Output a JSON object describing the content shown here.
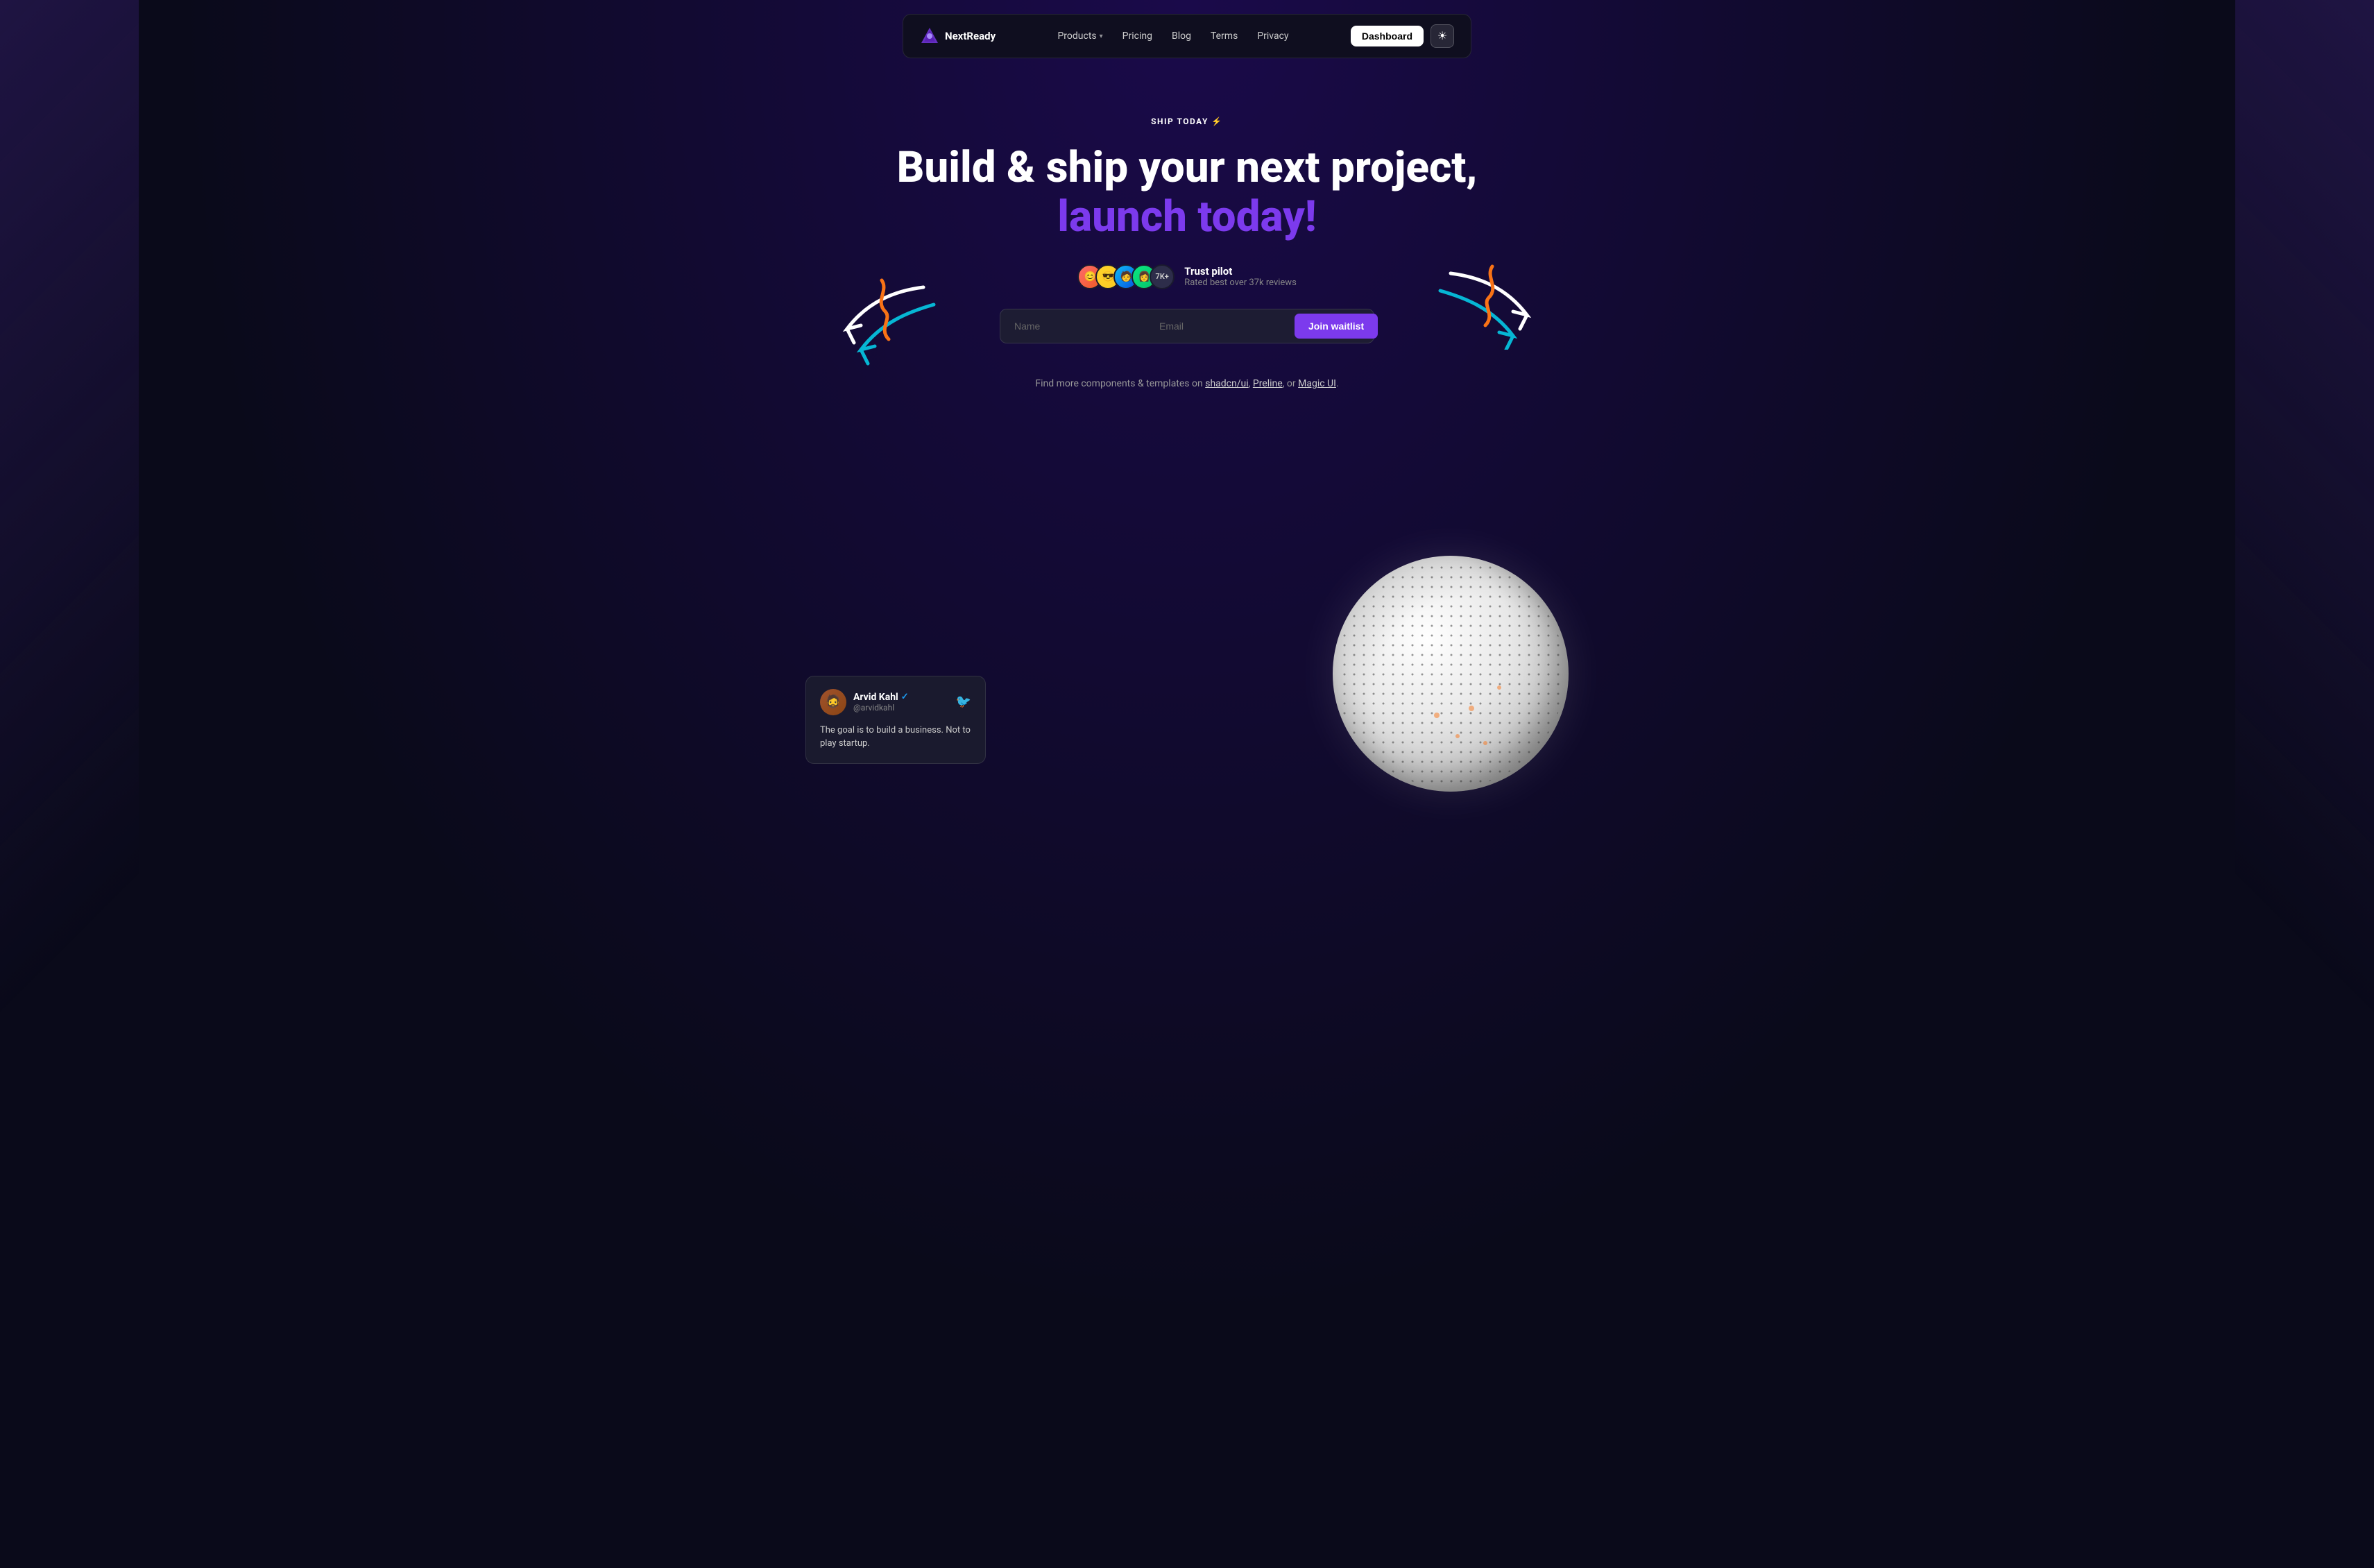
{
  "brand": {
    "name": "NextReady"
  },
  "nav": {
    "links": [
      {
        "label": "Products",
        "has_dropdown": true
      },
      {
        "label": "Pricing",
        "has_dropdown": false
      },
      {
        "label": "Blog",
        "has_dropdown": false
      },
      {
        "label": "Terms",
        "has_dropdown": false
      },
      {
        "label": "Privacy",
        "has_dropdown": false
      }
    ],
    "cta": "Dashboard",
    "theme_toggle_icon": "☀"
  },
  "hero": {
    "badge": "SHIP TODAY ⚡",
    "title_line1": "Build & ship your next project,",
    "title_line2": "launch today!",
    "trust": {
      "rating_count": "7K+",
      "platform": "Trust pilot",
      "subtitle": "Rated best over 37k reviews"
    }
  },
  "form": {
    "name_placeholder": "Name",
    "email_placeholder": "Email",
    "cta_label": "Join waitlist"
  },
  "find_more": {
    "text_before": "Find more components & templates on",
    "links": [
      {
        "label": "shadcn/ui"
      },
      {
        "label": "Preline"
      },
      {
        "label": "Magic UI"
      }
    ],
    "text_after": "."
  },
  "tweet": {
    "name": "Arvid Kahl",
    "handle": "@arvidkahl",
    "verified": true,
    "text": "The goal is to build a business. Not to play startup."
  },
  "colors": {
    "accent_purple": "#7c3aed",
    "accent_cyan": "#06b6d4",
    "accent_orange": "#f97316",
    "bg_dark": "#0a0a1a"
  }
}
